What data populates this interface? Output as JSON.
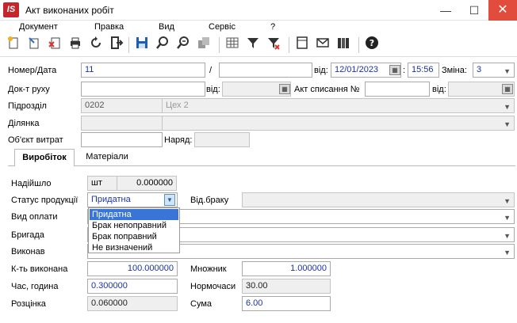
{
  "window": {
    "title": "Акт виконаних робіт",
    "app_icon_text": "IS",
    "minimize": "—",
    "maximize": "☐",
    "close": "✕"
  },
  "menu": [
    "Документ",
    "Правка",
    "Вид",
    "Сервіс",
    "?"
  ],
  "toolbar_icons": [
    "new-doc-icon",
    "edit-doc-icon",
    "delete-doc-icon",
    "print-icon",
    "refresh-icon",
    "exit-icon",
    "save-icon",
    "search-icon",
    "search-next-icon",
    "copy-icon",
    "grid-icon",
    "filter-icon",
    "filter-off-icon",
    "document-icon",
    "mail-icon",
    "library-icon",
    "help-icon"
  ],
  "header": {
    "number_date_label": "Номер/Дата",
    "number_value": "11",
    "slash": "/",
    "from_label": "від:",
    "date_value": "12/01/2023",
    "time_value": "15:56",
    "colon": ":",
    "shift_label": "Зміна:",
    "shift_value": "3",
    "movement_doc_label": "Док-т руху",
    "movement_from_label": "від:",
    "writeoff_label": "Акт списання №",
    "writeoff_from_label": "від:",
    "division_label": "Підрозділ",
    "division_code": "0202",
    "division_name": "Цех 2",
    "section_label": "Ділянка",
    "cost_object_label": "Об'єкт витрат",
    "order_label": "Наряд:"
  },
  "tabs": {
    "production": "Виробіток",
    "materials": "Матеріали"
  },
  "production": {
    "received_label": "Надійшло",
    "unit": "шт",
    "received_value": "0.000000",
    "status_label": "Статус продукції",
    "status_value": "Придатна",
    "defect_type_label": "Від.браку",
    "pay_type_label": "Вид оплати",
    "brigade_label": "Бригада",
    "performer_label": "Виконав",
    "qty_done_label": "К-ть виконана",
    "qty_done_value": "100.000000",
    "multiplier_label": "Множник",
    "multiplier_value": "1.000000",
    "time_hours_label": "Час, година",
    "time_hours_value": "0.300000",
    "norm_hours_label": "Нормочаси",
    "norm_hours_value": "30.00",
    "rate_label": "Розцінка",
    "rate_value": "0.060000",
    "sum_label": "Сума",
    "sum_value": "6.00"
  },
  "status_options": [
    "Придатна",
    "Брак непоправний",
    "Брак поправний",
    "Не визначений"
  ]
}
